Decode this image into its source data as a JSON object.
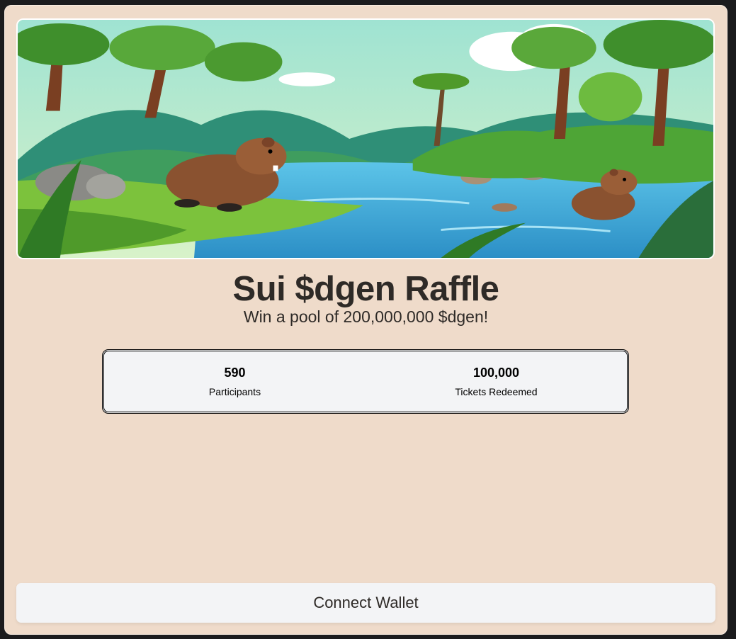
{
  "banner": {
    "icon": "jungle-river-capybara-illustration"
  },
  "header": {
    "title": "Sui $dgen Raffle",
    "subtitle": "Win a pool of 200,000,000 $dgen!"
  },
  "stats": [
    {
      "value": "590",
      "label": "Participants"
    },
    {
      "value": "100,000",
      "label": "Tickets Redeemed"
    }
  ],
  "actions": {
    "connect_label": "Connect Wallet"
  },
  "colors": {
    "card_background": "#efdbca",
    "page_background": "#1b1b1d",
    "panel_background": "#f3f4f6",
    "text": "#2e2a27"
  }
}
